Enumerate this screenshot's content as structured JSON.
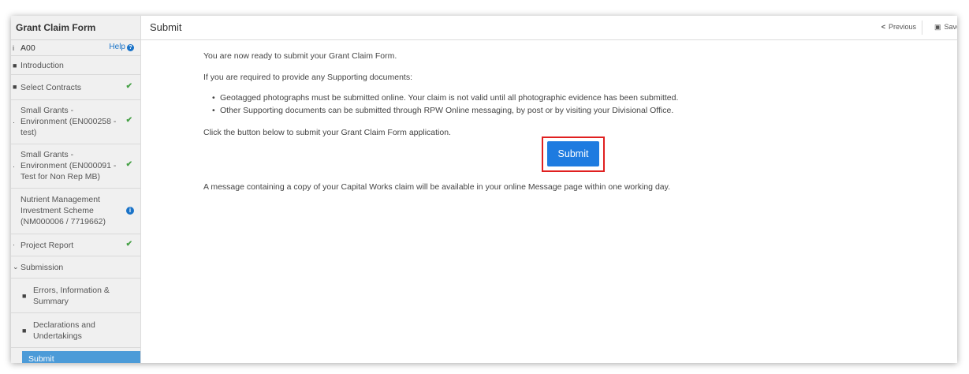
{
  "sidebar": {
    "title": "Grant Claim Form",
    "account": "A00",
    "help_label": "Help",
    "items": [
      {
        "label": "Introduction"
      },
      {
        "label": "Select Contracts"
      },
      {
        "label_lines": [
          "Small Grants -",
          "Environment (EN000258 -",
          "test)"
        ]
      },
      {
        "label_lines": [
          "Small Grants -",
          "Environment (EN000091 -",
          "Test for Non Rep MB)"
        ]
      },
      {
        "label_lines": [
          "Nutrient Management",
          "Investment Scheme",
          "(NM000006 / 7719662)"
        ]
      },
      {
        "label": "Project Report"
      },
      {
        "label": "Submission"
      },
      {
        "label_lines": [
          "Errors, Information &",
          "Summary"
        ]
      },
      {
        "label_lines": [
          "Declarations and",
          "Undertakings"
        ]
      },
      {
        "label": "Submit"
      }
    ]
  },
  "header": {
    "title": "Submit",
    "previous_label": "Previous",
    "save_label": "Save"
  },
  "main": {
    "intro": "You are now ready to submit your Grant Claim Form.",
    "supporting_heading": "If you are required to provide any Supporting documents:",
    "bullets": [
      "Geotagged photographs must be submitted online. Your claim is not valid until all photographic evidence has been submitted.",
      "Other Supporting documents can be submitted through RPW Online messaging, by post or by visiting your Divisional Office."
    ],
    "instruction": "Click the button below to submit your Grant Claim Form application.",
    "submit_label": "Submit",
    "footer_message": "A message containing a copy of your Capital Works claim will be available in your online Message page within one working day."
  },
  "colors": {
    "accent": "#1e7be0",
    "highlight_border": "#e02020",
    "check": "#46a046",
    "sidebar_active": "#4c9bd8"
  }
}
